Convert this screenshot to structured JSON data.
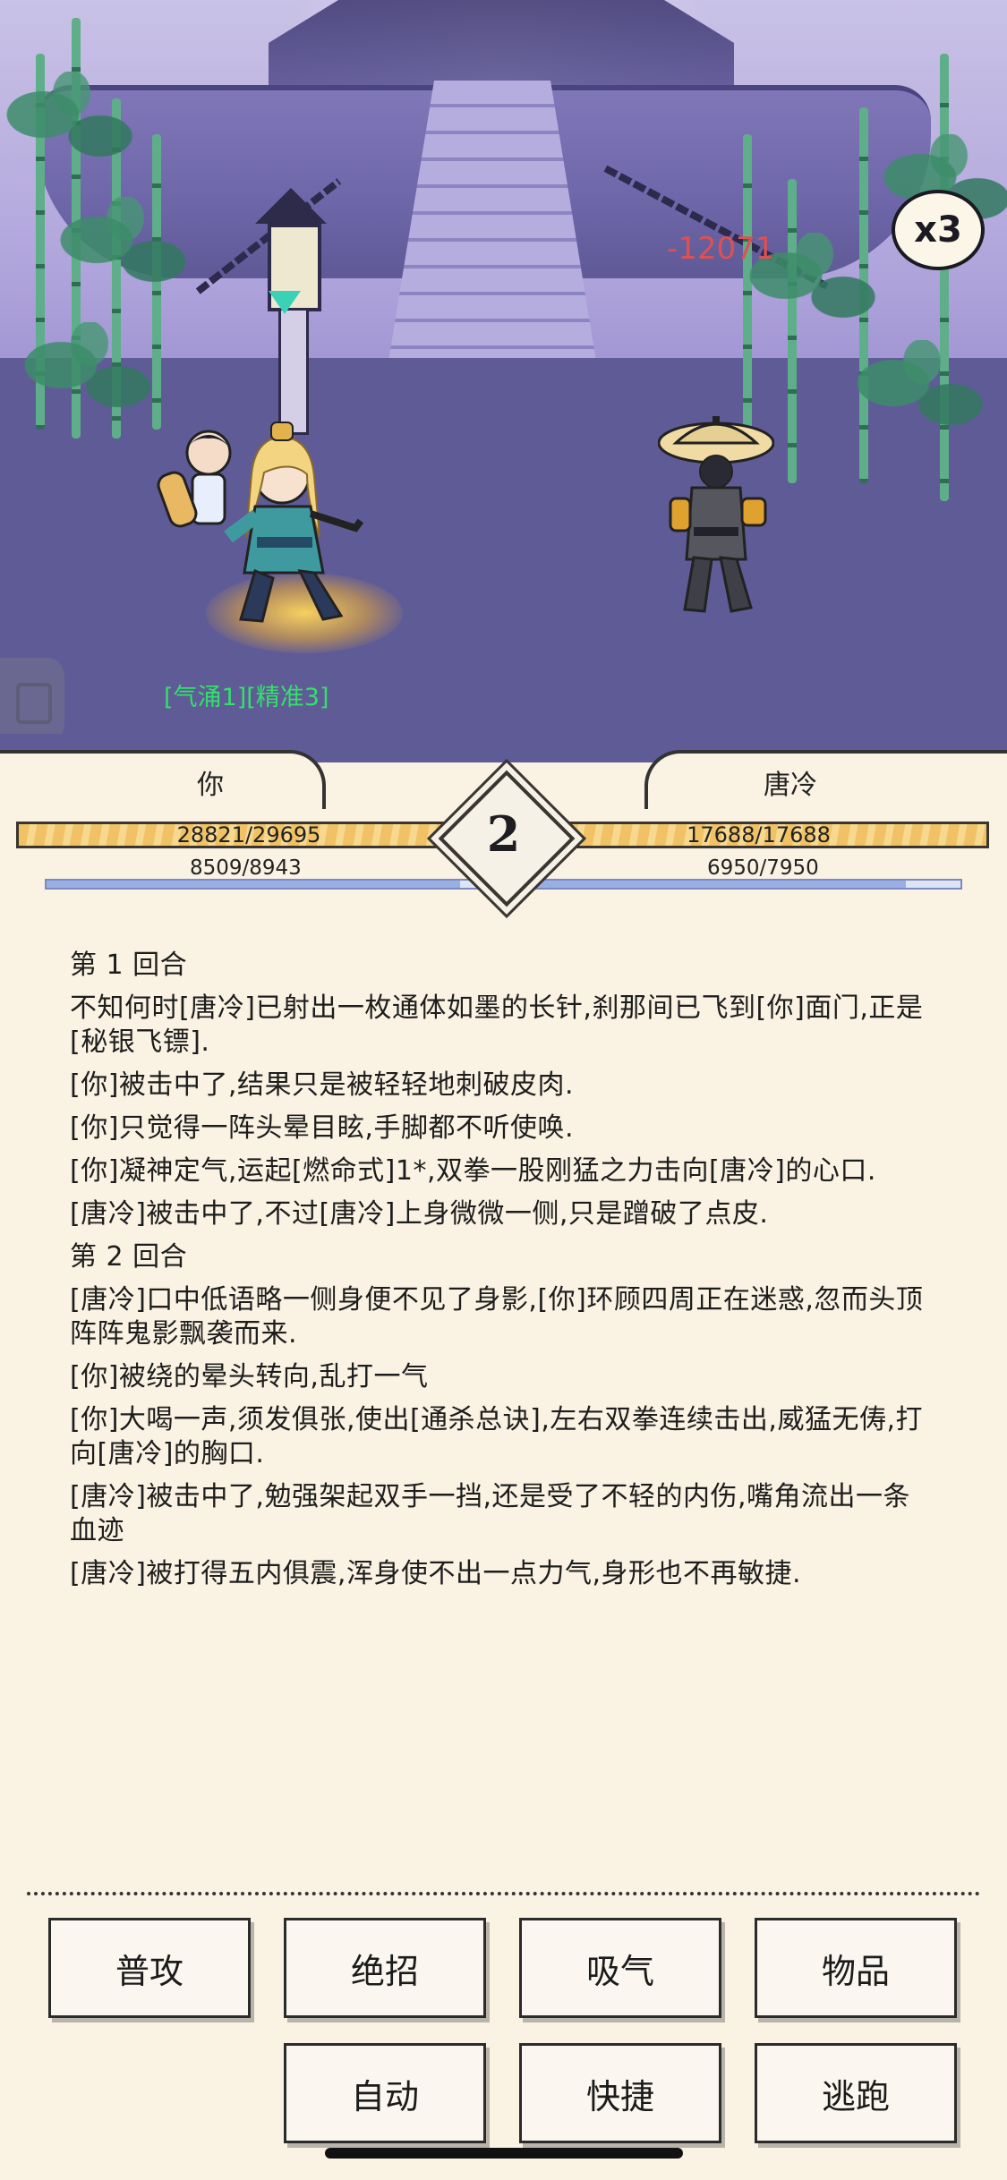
{
  "scene": {
    "damage_popup": "-12071",
    "speed_badge": "x3",
    "status_tags": "[气涌1][精准3]"
  },
  "player": {
    "name": "你",
    "hp_text": "28821/29695",
    "hp": 28821,
    "hp_max": 29695,
    "mp_text": "8509/8943",
    "mp": 8509,
    "mp_max": 8943
  },
  "enemy": {
    "name": "唐冷",
    "hp_text": "17688/17688",
    "hp": 17688,
    "hp_max": 17688,
    "mp_text": "6950/7950",
    "mp": 6950,
    "mp_max": 7950
  },
  "round": "2",
  "log": [
    "第 1 回合",
    "不知何时[唐冷]已射出一枚通体如墨的长针,刹那间已飞到[你]面门,正是[秘银飞镖].",
    "[你]被击中了,结果只是被轻轻地刺破皮肉.",
    "[你]只觉得一阵头晕目眩,手脚都不听使唤.",
    "[你]凝神定气,运起[燃命式]1*,双拳一股刚猛之力击向[唐冷]的心口.",
    "[唐冷]被击中了,不过[唐冷]上身微微一侧,只是蹭破了点皮.",
    "第 2 回合",
    "[唐冷]口中低语略一侧身便不见了身影,[你]环顾四周正在迷惑,忽而头顶阵阵鬼影飘袭而来.",
    "[你]被绕的晕头转向,乱打一气",
    "[你]大喝一声,须发俱张,使出[通杀总诀],左右双拳连续击出,威猛无俦,打向[唐冷]的胸口.",
    "[唐冷]被击中了,勉强架起双手一挡,还是受了不轻的内伤,嘴角流出一条血迹",
    "[唐冷]被打得五内俱震,浑身使不出一点力气,身形也不再敏捷."
  ],
  "buttons": {
    "attack": "普攻",
    "ultimate": "绝招",
    "breathe": "吸气",
    "items": "物品",
    "auto": "自动",
    "shortcut": "快捷",
    "flee": "逃跑"
  },
  "colors": {
    "hp_fill": "#f0c265",
    "mp_fill": "#9aaee6",
    "damage": "#e05050",
    "status": "#33e06a"
  }
}
